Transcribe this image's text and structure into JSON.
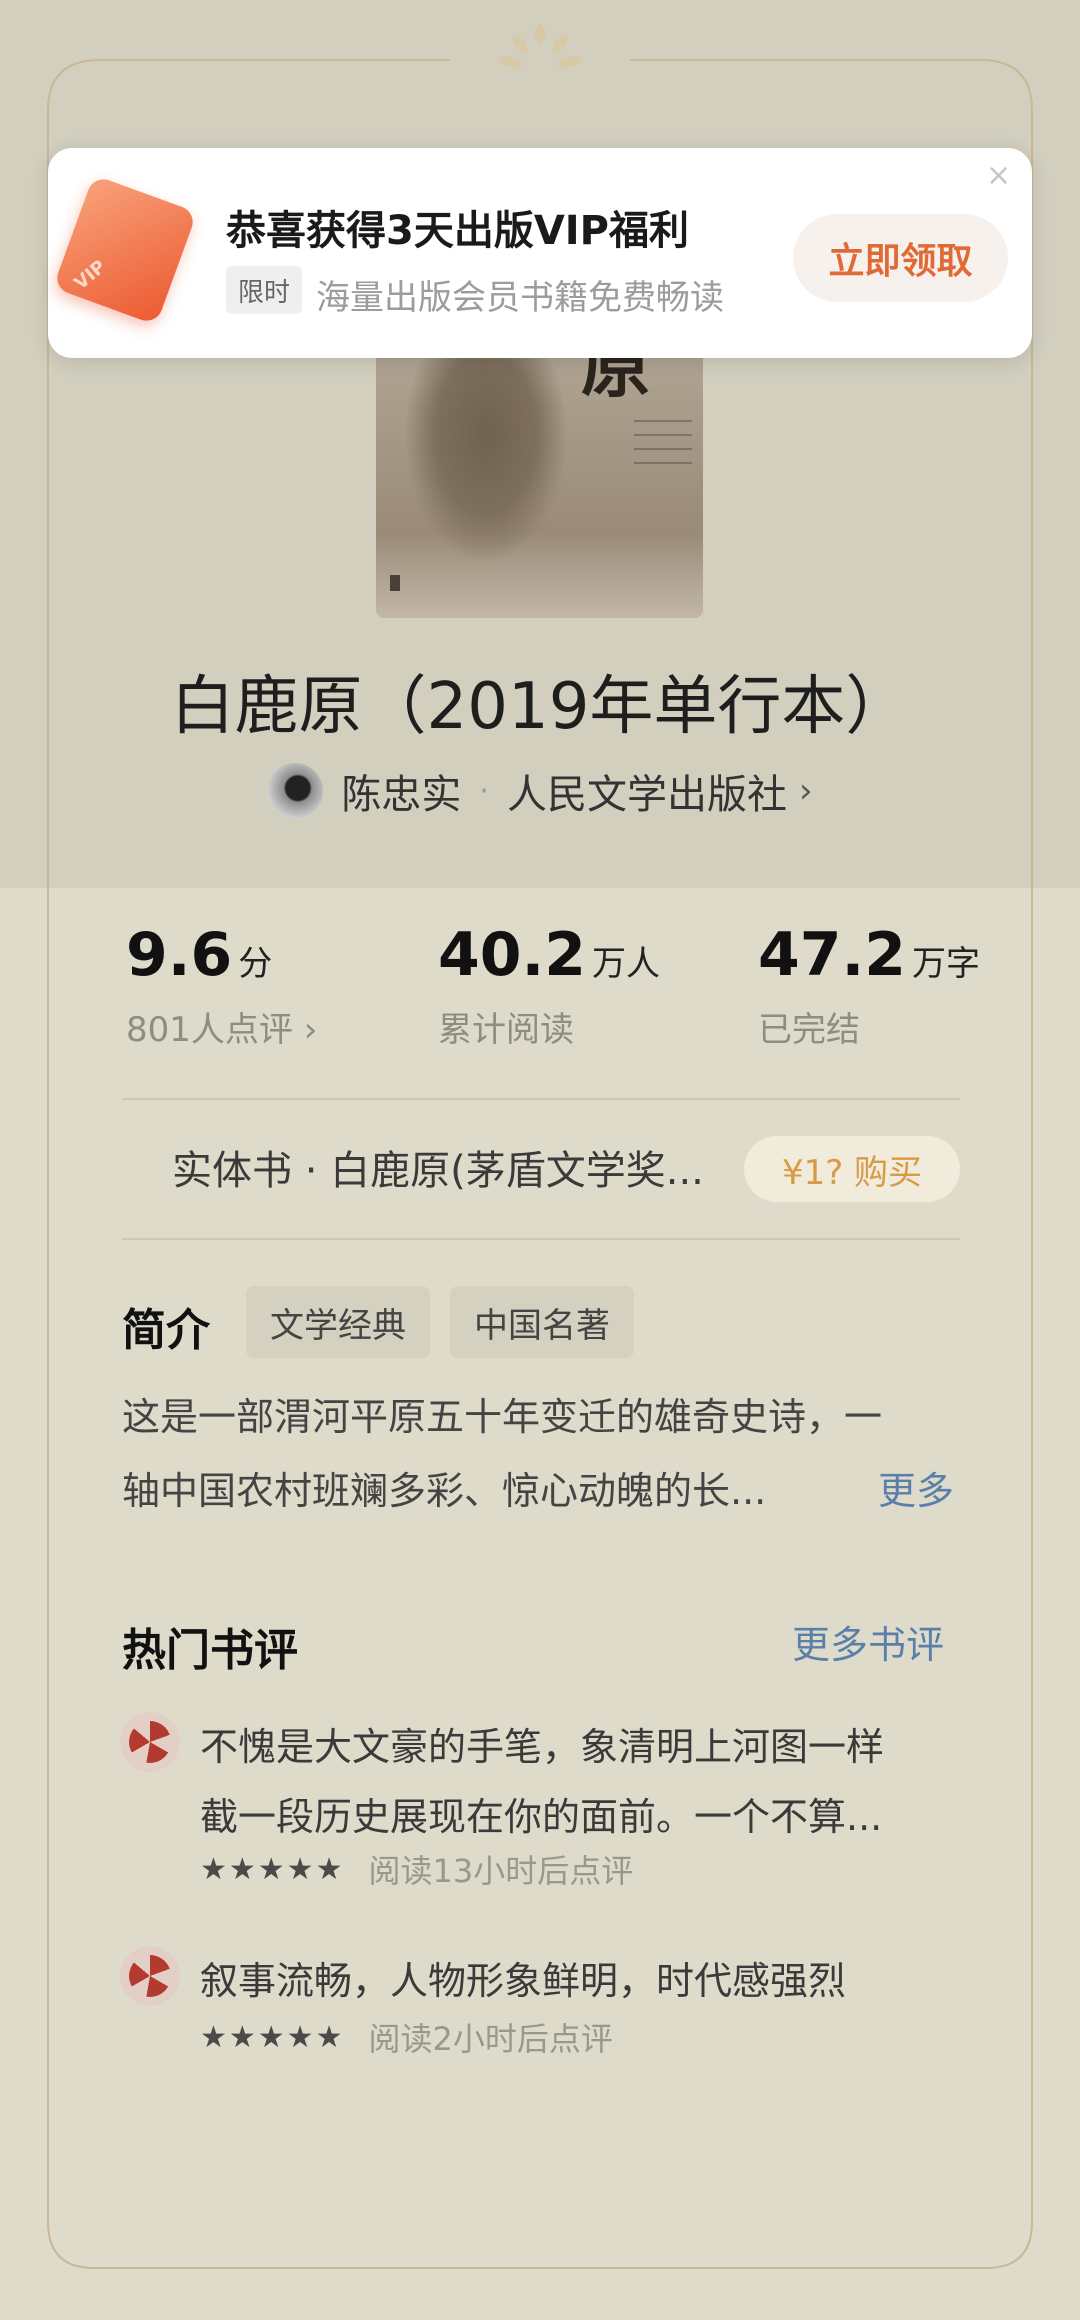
{
  "popup": {
    "title": "恭喜获得3天出版VIP福利",
    "tag": "限时",
    "subtitle": "海量出版会员书籍免费畅读",
    "button": "立即领取",
    "close_icon": "×",
    "card_text": "VIP"
  },
  "book": {
    "cover_char": "原",
    "title": "白鹿原（2019年单行本）",
    "author": "陈忠实",
    "separator": "·",
    "publisher": "人民文学出版社",
    "chevron": "›"
  },
  "stats": [
    {
      "value": "9.6",
      "unit": "分",
      "label": "801人点评 ›"
    },
    {
      "value": "40.2",
      "unit": "万人",
      "label": "累计阅读"
    },
    {
      "value": "47.2",
      "unit": "万字",
      "label": "已完结"
    }
  ],
  "physical": {
    "text": "实体书 · 白鹿原(茅盾文学奖...",
    "button": "¥1? 购买"
  },
  "intro": {
    "title": "简介",
    "tags": [
      "文学经典",
      "中国名著"
    ],
    "lines": [
      "这是一部渭河平原五十年变迁的雄奇史诗，一",
      "轴中国农村班斓多彩、惊心动魄的长..."
    ],
    "more": "更多"
  },
  "reviews": {
    "title": "热门书评",
    "more": "更多书评",
    "items": [
      {
        "lines": [
          "不愧是大文豪的手笔，象清明上河图一样",
          "截一段历史展现在你的面前。一个不算..."
        ],
        "stars": "★★★★★",
        "meta": "阅读13小时后点评"
      },
      {
        "lines": [
          "叙事流畅，人物形象鲜明，时代感强烈"
        ],
        "stars": "★★★★★",
        "meta": "阅读2小时后点评"
      }
    ]
  }
}
